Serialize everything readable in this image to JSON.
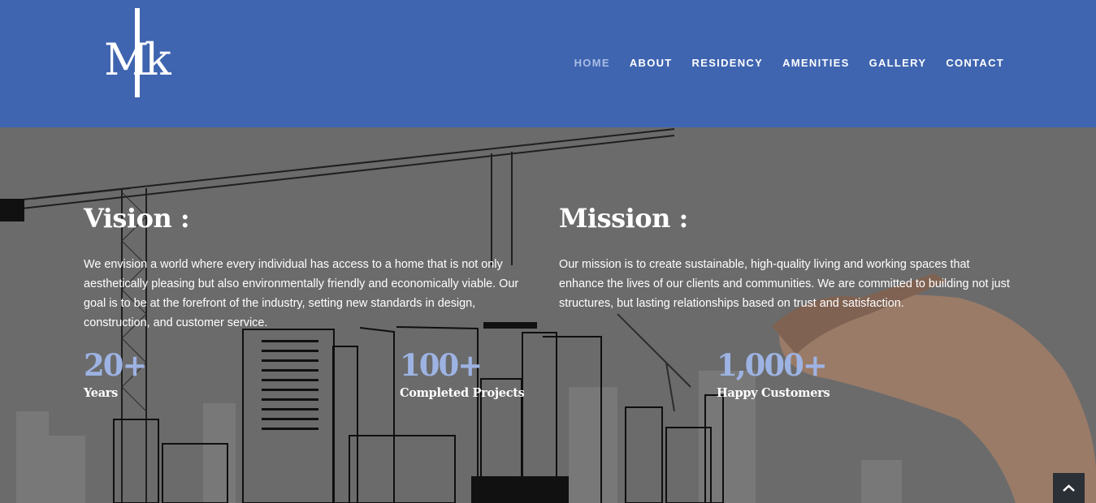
{
  "brand": {
    "logo_text": "MK"
  },
  "nav": {
    "items": [
      {
        "label": "HOME",
        "active": true
      },
      {
        "label": "ABOUT"
      },
      {
        "label": "RESIDENCY"
      },
      {
        "label": "AMENITIES"
      },
      {
        "label": "GALLERY"
      },
      {
        "label": "CONTACT"
      }
    ]
  },
  "vision": {
    "title": "Vision :",
    "text": "We envision a world where every individual has access to a home that is not only aesthetically pleasing but also environmentally friendly and economically viable. Our goal is to be at the forefront of the industry, setting new standards in design, construction, and customer service."
  },
  "mission": {
    "title": "Mission :",
    "text": "Our mission is to create sustainable, high-quality living and working spaces that enhance the lives of our clients and communities. We are committed to building not just structures, but lasting relationships based on trust and satisfaction."
  },
  "stats": [
    {
      "value": "20+",
      "label": "Years"
    },
    {
      "value": "100+",
      "label": "Completed Projects"
    },
    {
      "value": "1,000+",
      "label": "Happy Customers"
    }
  ],
  "colors": {
    "header": "#3f65b0",
    "accent": "#9db3e3",
    "nav_active": "#a9bde6"
  },
  "icons": {
    "back_to_top": "chevron-up-icon"
  }
}
